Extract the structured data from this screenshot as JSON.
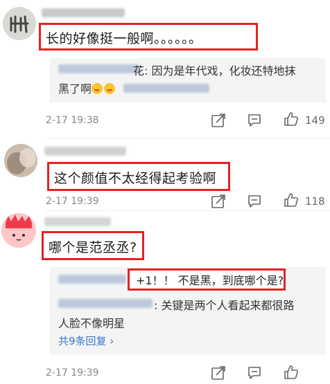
{
  "comments": [
    {
      "text": "长的好像挺一般啊。。。。。。",
      "reply": {
        "suffix": "花: 因为是年代戏，化妆还特地抹",
        "line2": "黑了啊"
      },
      "timestamp": "2-17 19:38",
      "likes": "149"
    },
    {
      "text": "这个颜值不太经得起考验啊",
      "timestamp": "2-17 19:39",
      "likes": "118"
    },
    {
      "text": "哪个是范丞丞?",
      "replies": [
        {
          "text": "+1！！ 不是黑，到底哪个是?"
        },
        {
          "suffix": ": 关键是两个人看起来都很路",
          "line2": "人脸不像明星"
        }
      ],
      "more_replies": "共9条回复 ›",
      "timestamp": "2-17 19:39"
    }
  ],
  "icons": [
    "share-icon",
    "comment-icon",
    "like-icon"
  ],
  "colors": {
    "highlight": "#e62020",
    "link": "#3a78c7",
    "muted": "#888888"
  }
}
